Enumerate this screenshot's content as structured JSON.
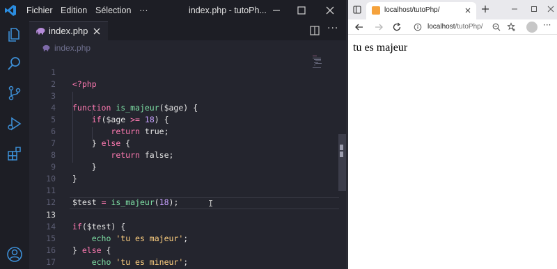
{
  "vscode": {
    "menu": [
      "Fichier",
      "Edition",
      "Sélection",
      "···"
    ],
    "window_title": "index.php - tutoPh...",
    "tab": {
      "label": "index.php",
      "icon": "php-elephant-icon"
    },
    "breadcrumb": "index.php",
    "editor": {
      "current_line": 13,
      "lines": [
        {
          "n": "1"
        },
        {
          "n": "2"
        },
        {
          "n": "3"
        },
        {
          "n": "4"
        },
        {
          "n": "5"
        },
        {
          "n": "6"
        },
        {
          "n": "7"
        },
        {
          "n": "8"
        },
        {
          "n": "9"
        },
        {
          "n": "10"
        },
        {
          "n": "11"
        },
        {
          "n": "12"
        },
        {
          "n": "13"
        },
        {
          "n": "14"
        },
        {
          "n": "15"
        },
        {
          "n": "16"
        },
        {
          "n": "17"
        }
      ],
      "code": {
        "l1": "<?php",
        "l3_kw": "function",
        "l3_fn": "is_majeur",
        "l3_rest": "($age) {",
        "l4_kw": "if",
        "l4_a": "($age ",
        "l4_op": ">=",
        "l4_num": "18",
        "l4_rest": ") {",
        "l5_kw": "return",
        "l5_val": "true;",
        "l6_a": "} ",
        "l6_kw": "else",
        "l6_rest": " {",
        "l7_kw": "return",
        "l7_val": "false;",
        "l8": "}",
        "l9": "}",
        "l11_var": "$test",
        "l11_op": "=",
        "l11_fn": "is_majeur",
        "l11_num": "18",
        "l13_kw": "if",
        "l13_rest": "($test) {",
        "l14_kw": "echo",
        "l14_str": "'tu es majeur'",
        "l14_end": ";",
        "l15_a": "} ",
        "l15_kw": "else",
        "l15_rest": " {",
        "l16_kw": "echo",
        "l16_str": "'tu es mineur'",
        "l16_end": ";",
        "l17": "}"
      }
    },
    "colors": {
      "keyword": "#ff7ab2",
      "function": "#7ee0a5",
      "string": "#ffd080",
      "number": "#c6a0ff",
      "background": "#24252e"
    }
  },
  "browser": {
    "tab_title": "localhost/tutoPhp/",
    "url_host": "localhost",
    "url_path": "/tutoPhp/",
    "page_output": "tu es majeur"
  }
}
